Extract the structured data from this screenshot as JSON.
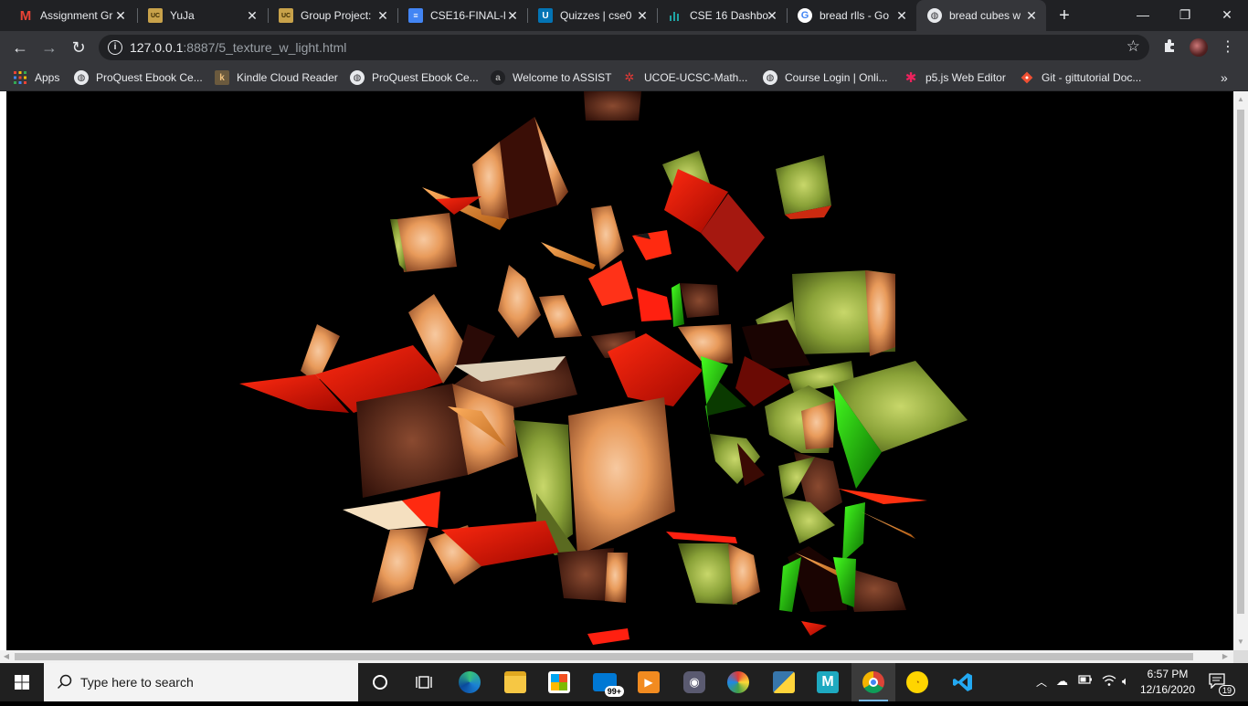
{
  "browser": {
    "tabs": [
      {
        "title": "Assignment Gr",
        "favicon": "gmail-icon",
        "color": "#ea4335"
      },
      {
        "title": "YuJa",
        "favicon": "yuja-icon",
        "color": "#c8a24a"
      },
      {
        "title": "Group Project:",
        "favicon": "ucsc-icon",
        "color": "#c8a24a"
      },
      {
        "title": "CSE16-FINAL-l",
        "favicon": "docs-icon",
        "color": "#4285f4"
      },
      {
        "title": "Quizzes | cse0",
        "favicon": "canvas-icon",
        "color": "#0374b5"
      },
      {
        "title": "CSE 16 Dashbo",
        "favicon": "chart-icon",
        "color": "#1fa3a3"
      },
      {
        "title": "bread rlls - Go",
        "favicon": "google-icon",
        "color": "#ffffff"
      },
      {
        "title": "bread cubes w",
        "favicon": "globe-icon",
        "color": "#ffffff",
        "active": true
      }
    ],
    "url_host": "127.0.0.1",
    "url_rest": ":8887/5_texture_w_light.html",
    "bookmarks": [
      {
        "label": "Apps",
        "icon": "apps-grid-icon"
      },
      {
        "label": "ProQuest Ebook Ce...",
        "icon": "globe-icon"
      },
      {
        "label": "Kindle Cloud Reader",
        "icon": "kindle-icon"
      },
      {
        "label": "ProQuest Ebook Ce...",
        "icon": "globe-icon"
      },
      {
        "label": "Welcome to ASSIST",
        "icon": "assist-icon"
      },
      {
        "label": "UCOE-UCSC-Math...",
        "icon": "ucoe-icon"
      },
      {
        "label": "Course Login | Onli...",
        "icon": "globe-icon"
      },
      {
        "label": "p5.js Web Editor",
        "icon": "p5-icon"
      },
      {
        "label": "Git - gittutorial Doc...",
        "icon": "git-icon"
      }
    ]
  },
  "taskbar": {
    "search_placeholder": "Type here to search",
    "mail_badge": "99+",
    "time": "6:57 PM",
    "date": "12/16/2020",
    "notifications": "19"
  }
}
